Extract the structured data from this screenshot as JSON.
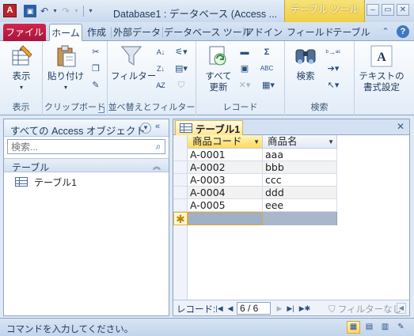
{
  "window": {
    "app_icon_letter": "A",
    "title": "Database1 : データベース (Access ...",
    "contextual_header": "テーブル ツール"
  },
  "qat": {
    "undo": "↶",
    "redo": "↷"
  },
  "tabs": [
    {
      "label": "ファイル",
      "state": "file"
    },
    {
      "label": "ホーム",
      "state": "active"
    },
    {
      "label": "作成",
      "state": "normal"
    },
    {
      "label": "外部データ",
      "state": "normal"
    },
    {
      "label": "データベース ツール",
      "state": "normal"
    },
    {
      "label": "アドイン",
      "state": "normal"
    },
    {
      "label": "フィールド",
      "state": "contextual"
    },
    {
      "label": "テーブル",
      "state": "contextual"
    }
  ],
  "ribbon": {
    "view": {
      "button": "表示",
      "group": "表示"
    },
    "clipboard": {
      "button": "貼り付け",
      "group": "クリップボード"
    },
    "sort_filter": {
      "button": "フィルター",
      "group": "並べ替えとフィルター"
    },
    "records": {
      "button_line1": "すべて",
      "button_line2": "更新",
      "group": "レコード",
      "sum_symbol": "Σ",
      "spell_label": "ABC"
    },
    "find": {
      "button": "検索",
      "group": "検索"
    },
    "text_format": {
      "button_line1": "テキストの",
      "button_line2": "書式設定",
      "icon_letter": "A"
    }
  },
  "nav_pane": {
    "title": "すべての Access オブジェクト",
    "search_placeholder": "検索...",
    "group_label": "テーブル",
    "items": [
      {
        "label": "テーブル1"
      }
    ]
  },
  "document": {
    "tab_label": "テーブル1",
    "columns": [
      {
        "label": "商品コード",
        "active": true
      },
      {
        "label": "商品名",
        "active": false
      }
    ],
    "rows": [
      [
        "A-0001",
        "aaa"
      ],
      [
        "A-0002",
        "bbb"
      ],
      [
        "A-0003",
        "ccc"
      ],
      [
        "A-0004",
        "ddd"
      ],
      [
        "A-0005",
        "eee"
      ]
    ],
    "new_record_marker": "✱",
    "record_nav": {
      "label": "レコード:",
      "position": "6 / 6",
      "filter_status": "フィルターなし"
    }
  },
  "statusbar": {
    "text": "コマンドを入力してください。"
  },
  "colors": {
    "file_tab": "#b91d45",
    "contextual_tab": "#f0cf45",
    "active_column": "#ffd95a",
    "accent": "#2b4f81"
  }
}
